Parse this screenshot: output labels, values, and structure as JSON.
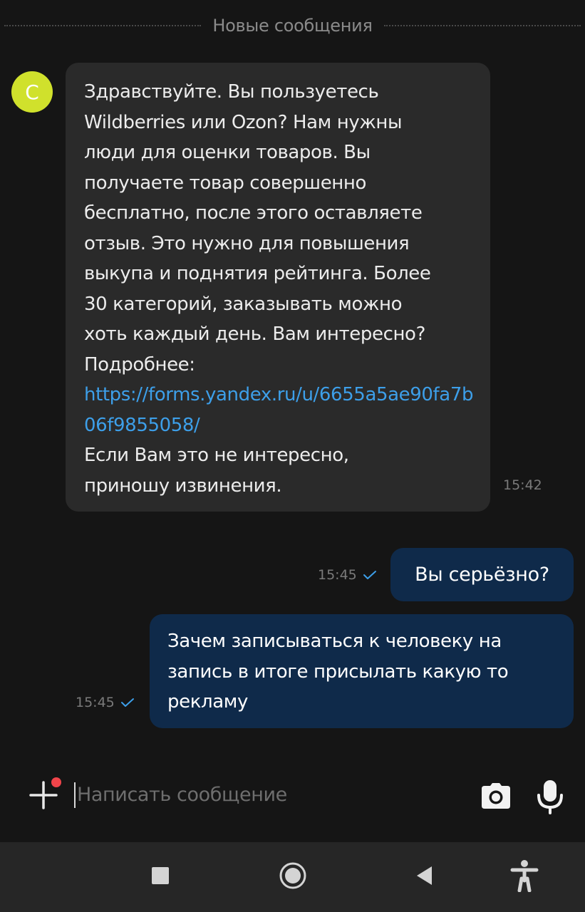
{
  "divider": {
    "label": "Новые сообщения"
  },
  "incoming": {
    "avatar_letter": "С",
    "avatar_color": "#d0e12c",
    "text_main": "Здравствуйте. Вы пользуетесь\nWildberries или Ozon? Нам нужны\nлюди для оценки товаров. Вы\nполучаете товар совершенно\nбесплатно, после этого оставляете\nотзыв. Это нужно для повышения\nвыкупа и поднятия рейтинга. Более\n30 категорий, заказывать можно\nхоть каждый день. Вам интересно?\nПодробнее:",
    "link": "https://forms.yandex.ru/u/6655a5ae90fa7b06f9855058/",
    "text_after": "Если Вам это не интересно,\nприношу извинения.",
    "time": "15:42"
  },
  "outgoing": [
    {
      "text": "Вы серьёзно?",
      "time": "15:45",
      "status": "sent-check"
    },
    {
      "text": "Зачем записываться к человеку на\nзапись в итоге присылать какую то\nрекламу",
      "time": "15:45",
      "status": "sent-check"
    }
  ],
  "composer": {
    "placeholder": "Написать сообщение",
    "attach_icon": "plus-icon",
    "camera_icon": "camera-icon",
    "mic_icon": "microphone-icon"
  },
  "navbar": {
    "items": [
      "stop-square-icon",
      "home-circle-icon",
      "back-triangle-icon",
      "accessibility-icon"
    ]
  },
  "colors": {
    "background": "#151515",
    "incoming_bubble": "#2a2a2a",
    "outgoing_bubble": "#0f2a4a",
    "link": "#3d9fe9",
    "check": "#3d9fe9",
    "notification_dot": "#f0444a"
  }
}
